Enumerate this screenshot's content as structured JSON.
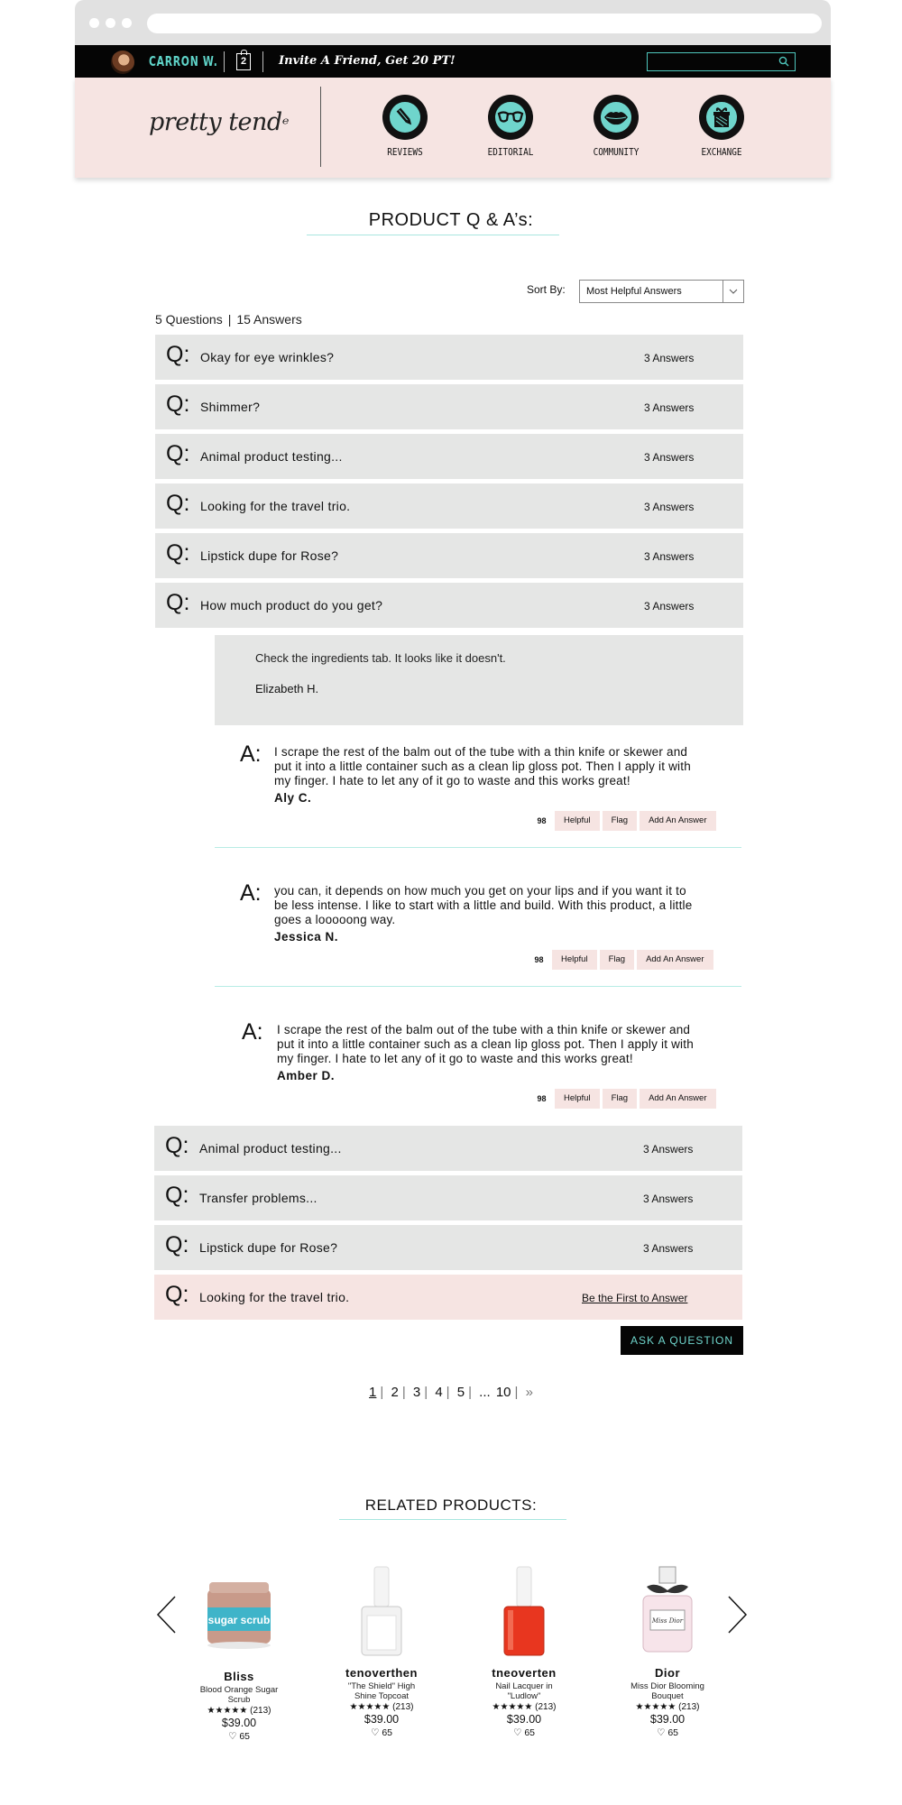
{
  "topbar": {
    "username": "CARRON W.",
    "bag_count": "2",
    "invite_text": "Invite A Friend, Get 20 PT!",
    "search_placeholder": ""
  },
  "header": {
    "logo_text": "pretty tend",
    "nav": [
      {
        "label": "REVIEWS",
        "icon": "pencil-icon"
      },
      {
        "label": "EDITORIAL",
        "icon": "glasses-icon"
      },
      {
        "label": "COMMUNITY",
        "icon": "lips-icon"
      },
      {
        "label": "EXCHANGE",
        "icon": "gift-icon"
      }
    ]
  },
  "qa": {
    "title": "PRODUCT Q & A’s:",
    "sort_label": "Sort By:",
    "sort_value": "Most Helpful Answers",
    "questions_count": "5 Questions",
    "answers_count": "15 Answers",
    "q_mark": "Q:",
    "a_mark": "A:",
    "questions_top": [
      {
        "text": "Okay for eye wrinkles?",
        "answers": "3 Answers"
      },
      {
        "text": "Shimmer?",
        "answers": "3 Answers"
      },
      {
        "text": "Animal product testing...",
        "answers": "3 Answers"
      },
      {
        "text": "Looking for the travel trio.",
        "answers": "3 Answers"
      },
      {
        "text": "Lipstick dupe for Rose?",
        "answers": "3 Answers"
      },
      {
        "text": "How much product do you get?",
        "answers": "3 Answers"
      }
    ],
    "expanded_note": {
      "text": "Check the ingredients tab. It looks like it doesn't.",
      "author": "Elizabeth H."
    },
    "answers": [
      {
        "line1": "I scrape the rest of the balm out of the tube with a thin knife or skewer and",
        "line2": "put it into a little container such as a clean lip gloss pot. Then I apply it with",
        "line3": "my finger. I hate to let any of it go to waste and this works great!",
        "author": "Aly C.",
        "helpful_count": "98"
      },
      {
        "line1": "you can, it depends on how much you get on your lips and if you want it to",
        "line2": "be less intense. I like to start with a little and build. With this product, a little",
        "line3": "goes a looooong way.",
        "author": "Jessica N.",
        "helpful_count": "98"
      },
      {
        "line1": "I scrape the rest of the balm out of the tube with a thin knife or skewer and",
        "line2": "put it into a little container such as a clean lip gloss pot. Then I apply it with",
        "line3": "my finger. I hate to let any of it go to waste and this works great!",
        "author": "Amber D.",
        "helpful_count": "98"
      }
    ],
    "actions": {
      "helpful": "Helpful",
      "flag": "Flag",
      "add_answer": "Add An Answer"
    },
    "questions_bottom": [
      {
        "text": "Animal product testing...",
        "answers": "3 Answers"
      },
      {
        "text": "Transfer problems...",
        "answers": "3 Answers"
      },
      {
        "text": "Lipstick dupe for Rose?",
        "answers": "3 Answers"
      }
    ],
    "unanswered": {
      "text": "Looking for the travel trio.",
      "cta": "Be the First to Answer"
    },
    "ask_button": "ASK A QUESTION"
  },
  "pagination": {
    "pages": [
      "1",
      "2",
      "3",
      "4",
      "5"
    ],
    "ellipsis": "...",
    "last": "10",
    "next": "»"
  },
  "related": {
    "title": "RELATED PRODUCTS:",
    "products": [
      {
        "brand": "Bliss",
        "name_line1": "Blood Orange Sugar",
        "name_line2": "Scrub",
        "stars": "★★★★★",
        "reviews": "(213)",
        "price": "$39.00",
        "likes": "65",
        "image_label": "sugar scrub"
      },
      {
        "brand": "tenoverthen",
        "name_line1": "\"The Shield\" High",
        "name_line2": "Shine Topcoat",
        "stars": "★★★★★",
        "reviews": "(213)",
        "price": "$39.00",
        "likes": "65"
      },
      {
        "brand": "tneoverten",
        "name_line1": "Nail Lacquer in",
        "name_line2": "\"Ludlow\"",
        "stars": "★★★★★",
        "reviews": "(213)",
        "price": "$39.00",
        "likes": "65"
      },
      {
        "brand": "Dior",
        "name_line1": "Miss Dior Blooming",
        "name_line2": "Bouquet",
        "stars": "★★★★★",
        "reviews": "(213)",
        "price": "$39.00",
        "likes": "65",
        "image_label": "Miss Dior"
      }
    ]
  },
  "colors": {
    "accent_teal": "#6fd5cc",
    "pink": "#f6e4e2",
    "row_gray": "#e5e6e5",
    "black": "#050505"
  }
}
